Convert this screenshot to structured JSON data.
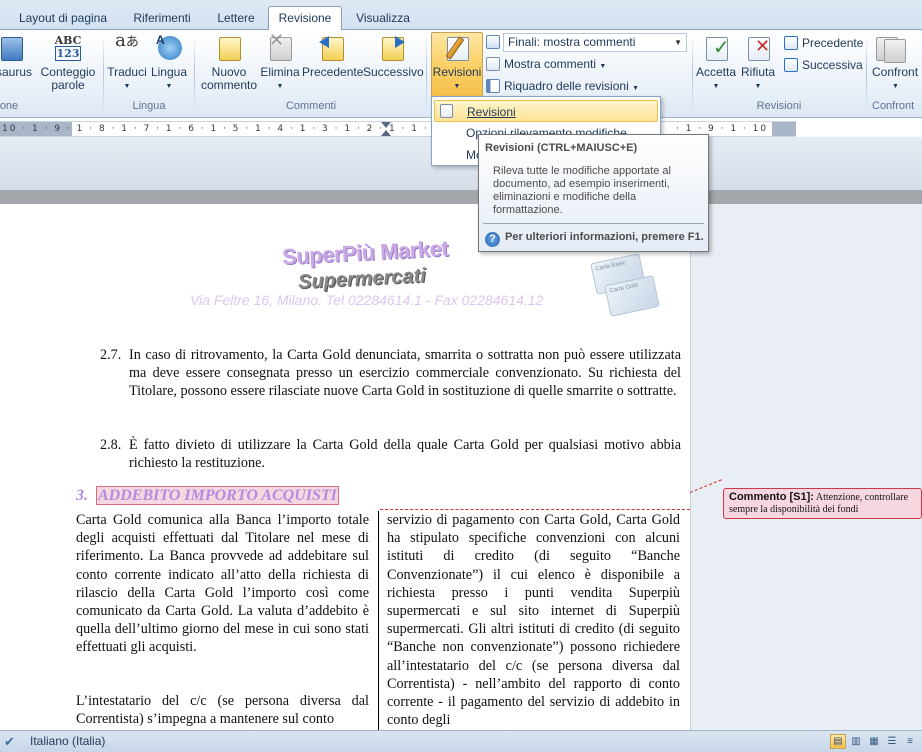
{
  "tabs": [
    {
      "label": "Layout di pagina",
      "active": false
    },
    {
      "label": "Riferimenti",
      "active": false
    },
    {
      "label": "Lettere",
      "active": false
    },
    {
      "label": "Revisione",
      "active": true
    },
    {
      "label": "Visualizza",
      "active": false
    }
  ],
  "ribbon": {
    "proofing": {
      "thesaurus_label": "saurus",
      "wordcount_line1": "Conteggio",
      "wordcount_line2": "parole",
      "group_label": "one"
    },
    "language": {
      "translate_label": "Traduci",
      "language_label": "Lingua",
      "group_label": "Lingua"
    },
    "comments": {
      "new_line1": "Nuovo",
      "new_line2": "commento",
      "delete_label": "Elimina",
      "previous_label": "Precedente",
      "next_label": "Successivo",
      "group_label": "Commenti"
    },
    "tracking": {
      "revisioni_label": "Revisioni",
      "display_combo": "Finali: mostra commenti",
      "show_markup": "Mostra commenti",
      "reviewing_pane": "Riquadro delle revisioni"
    },
    "changes": {
      "accept_label": "Accetta",
      "reject_label": "Rifiuta",
      "previous_label": "Precedente",
      "next_label": "Successiva",
      "group_label": "Revisioni"
    },
    "compare": {
      "compare_label": "Confront",
      "group_label": "Confront"
    }
  },
  "menu": {
    "items": [
      {
        "label": "Revisioni",
        "highlighted": true
      },
      {
        "label": "Opzioni rilevamento modifiche",
        "highlighted": false
      },
      {
        "label": "Mo",
        "highlighted": false
      }
    ]
  },
  "tooltip": {
    "title": "Revisioni (CTRL+MAIUSC+E)",
    "body": "Rileva tutte le modifiche apportate al documento, ad esempio inserimenti, eliminazioni e modifiche della formattazione.",
    "help": "Per ulteriori informazioni, premere F1.",
    "help_icon": "?"
  },
  "ruler": {
    "left_text": "10 · 1 · 9 · 1 · 8 · 1 · 7 · 1 · 6 · 1 · 5 · 1 · 4 · 1 · 3 · 1 · 2 · 1 · 1 ·",
    "right_text": "· 1 · 9 · 1 · 10 · 1"
  },
  "document": {
    "logo_title": "SuperPiù Market",
    "logo_subtitle": "Supermercati",
    "logo_address": "Via Feltre 16, Milano. Tel 02284614.1 - Fax 02284614.12",
    "card1": "Carta Basic",
    "card2": "Carta Gold",
    "p27_num": "2.7.",
    "p27_text": "In caso di ritrovamento, la Carta Gold denunciata, smarrita o sottratta non può essere utilizzata ma deve essere consegnata presso un esercizio commerciale convenzionato. Su richiesta del Titolare, possono essere rilasciate nuove Carta Gold in sostituzione di quelle smarrite o sottratte.",
    "p28_num": "2.8.",
    "p28_text": "È fatto divieto di utilizzare la Carta Gold della quale Carta Gold per qualsiasi motivo abbia richiesto la restituzione.",
    "section_num": "3.",
    "section_title": "ADDEBITO IMPORTO ACQUISTI",
    "col1_p1": "Carta Gold comunica alla Banca l’importo totale degli acquisti effettuati dal Titolare nel mese di riferimento. La Banca provvede ad addebitare sul conto corrente indicato all’atto della richiesta di rilascio della Carta Gold l’importo così come comunicato da Carta Gold. La valuta d’addebito è quella dell’ultimo giorno del mese in cui sono stati effettuati gli acquisti.",
    "col1_p2": "L’intestatario del c/c (se persona diversa dal Correntista) s’impegna a mantenere sul conto",
    "col2_p1": "servizio di pagamento con Carta Gold, Carta Gold ha stipulato specifiche convenzioni con alcuni istituti di credito (di seguito “Banche Convenzionate”) il cui elenco è disponibile a richiesta presso i punti vendita Superpiù supermercati e sul sito internet di Superpiù supermercati. Gli altri istituti di credito (di seguito “Banche non convenzionate”) possono richiedere all’intestatario del c/c (se persona diversa dal Correntista) - nell’ambito del rapporto di conto corrente - il pagamento del servizio di addebito in conto degli"
  },
  "comment": {
    "label": "Commento [S1]:",
    "text": "Attenzione, controllare sempre la disponibilità dei fondi"
  },
  "statusbar": {
    "language": "Italiano (Italia)",
    "proof_icon": "spellcheck-icon"
  },
  "colors": {
    "accent": "#f8c04a",
    "comment_bg": "#f7d7df",
    "comment_border": "#d03848",
    "heading": "#b38be0"
  }
}
